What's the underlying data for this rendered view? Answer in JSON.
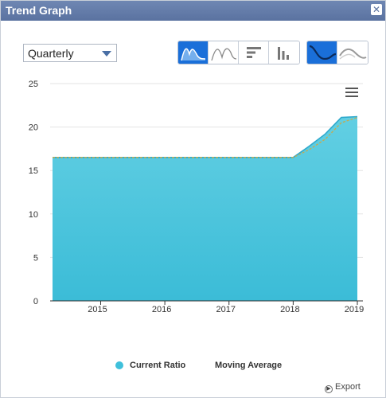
{
  "window": {
    "title": "Trend Graph",
    "close_glyph": "✕"
  },
  "period_select": {
    "value": "Quarterly"
  },
  "chart_type_buttons": [
    {
      "icon": "area-chart-icon",
      "active": true
    },
    {
      "icon": "line-chart-icon",
      "active": false
    },
    {
      "icon": "horizontal-bar-chart-icon",
      "active": false
    },
    {
      "icon": "column-chart-icon",
      "active": false
    }
  ],
  "smoothing_buttons": [
    {
      "icon": "smooth-curve-icon",
      "active": true
    },
    {
      "icon": "smooth-curve-alt-icon",
      "active": false
    }
  ],
  "chart_data": {
    "type": "area",
    "yticks": [
      "0",
      "5",
      "10",
      "15",
      "20",
      "25"
    ],
    "ylim": [
      0,
      25
    ],
    "xticks": [
      "2015",
      "2016",
      "2017",
      "2018",
      "2019"
    ],
    "x": [
      "2014-Q2",
      "2014-Q3",
      "2014-Q4",
      "2015-Q1",
      "2015-Q2",
      "2015-Q3",
      "2015-Q4",
      "2016-Q1",
      "2016-Q2",
      "2016-Q3",
      "2016-Q4",
      "2017-Q1",
      "2017-Q2",
      "2017-Q3",
      "2017-Q4",
      "2018-Q1",
      "2018-Q2",
      "2018-Q3",
      "2018-Q4",
      "2019-Q1"
    ],
    "series": [
      {
        "name": "Current Ratio",
        "type": "area",
        "color": "#3fc0db",
        "values": [
          16.5,
          16.5,
          16.5,
          16.5,
          16.5,
          16.5,
          16.5,
          16.5,
          16.5,
          16.5,
          16.5,
          16.5,
          16.5,
          16.5,
          16.5,
          16.5,
          17.8,
          19.2,
          21.1,
          21.2
        ]
      },
      {
        "name": "Moving Average",
        "type": "line",
        "color": "#c9a94b",
        "values": [
          16.5,
          16.5,
          16.5,
          16.5,
          16.5,
          16.5,
          16.5,
          16.5,
          16.5,
          16.5,
          16.5,
          16.5,
          16.5,
          16.5,
          16.5,
          16.5,
          17.4,
          18.6,
          20.5,
          21.1
        ]
      }
    ],
    "grid": true,
    "legend_position": "bottom"
  },
  "legend": {
    "current_ratio": "Current Ratio",
    "moving_average": "Moving Average"
  },
  "export": {
    "label": "Export"
  }
}
